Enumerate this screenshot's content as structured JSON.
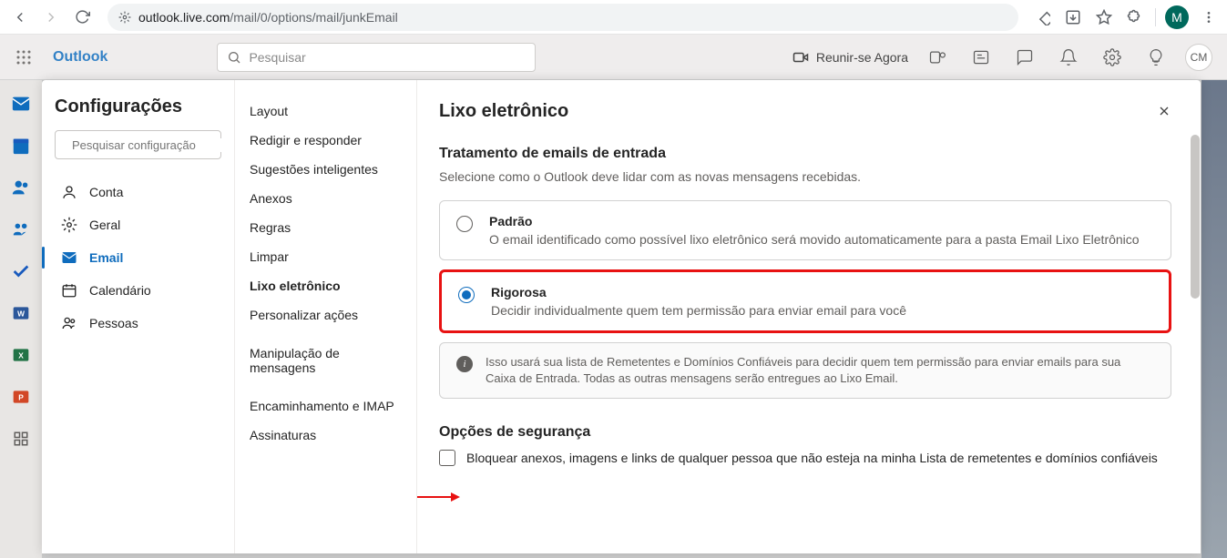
{
  "browser": {
    "domain": "outlook.live.com",
    "path": "/mail/0/options/mail/junkEmail",
    "avatar_letter": "M"
  },
  "outlook_bar": {
    "brand": "Outlook",
    "search_placeholder": "Pesquisar",
    "meet_now": "Reunir-se Agora",
    "avatar": "CM"
  },
  "settings": {
    "title": "Configurações",
    "search_placeholder": "Pesquisar configuração",
    "nav": [
      {
        "label": "Conta",
        "icon": "person"
      },
      {
        "label": "Geral",
        "icon": "gear"
      },
      {
        "label": "Email",
        "icon": "mail",
        "active": true
      },
      {
        "label": "Calendário",
        "icon": "calendar"
      },
      {
        "label": "Pessoas",
        "icon": "people"
      }
    ],
    "subnav": [
      "Layout",
      "Redigir e responder",
      "Sugestões inteligentes",
      "Anexos",
      "Regras",
      "Limpar",
      "Lixo eletrônico",
      "Personalizar ações"
    ],
    "subnav2": [
      "Manipulação de mensagens",
      "Encaminhamento e IMAP",
      "Assinaturas"
    ],
    "subnav_active": "Lixo eletrônico",
    "page_title": "Lixo eletrônico",
    "section1": {
      "title": "Tratamento de emails de entrada",
      "desc": "Selecione como o Outlook deve lidar com as novas mensagens recebidas.",
      "options": [
        {
          "label": "Padrão",
          "desc": "O email identificado como possível lixo eletrônico será movido automaticamente para a pasta Email Lixo Eletrônico",
          "checked": false
        },
        {
          "label": "Rigorosa",
          "desc": "Decidir individualmente quem tem permissão para enviar email para você",
          "checked": true
        }
      ],
      "info": "Isso usará sua lista de Remetentes e Domínios Confiáveis para decidir quem tem permissão para enviar emails para sua Caixa de Entrada. Todas as outras mensagens serão entregues ao Lixo Email."
    },
    "section2": {
      "title": "Opções de segurança",
      "checkbox1": "Bloquear anexos, imagens e links de qualquer pessoa que não esteja na minha Lista de remetentes e domínios confiáveis"
    }
  }
}
